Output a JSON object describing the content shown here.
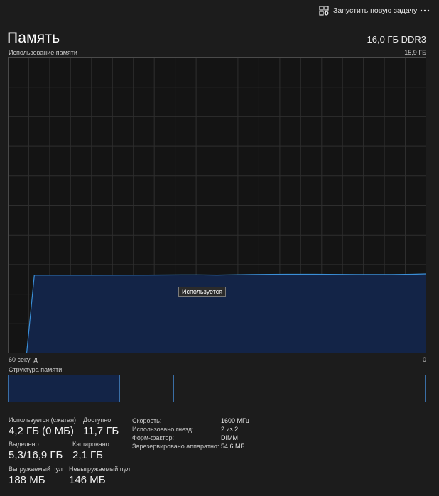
{
  "toolbar": {
    "run_task_label": "Запустить новую задачу",
    "more_label": "...",
    "run_task_icon": "new-task-icon",
    "more_icon": "more-horizontal-icon"
  },
  "header": {
    "title": "Память",
    "total": "16,0 ГБ DDR3",
    "usage_label": "Использование памяти",
    "usage_max": "15,9 ГБ"
  },
  "chart_data": {
    "type": "area",
    "x_range": [
      60,
      0
    ],
    "xlabel_left": "60 секунд",
    "xlabel_right": "0",
    "ylim": [
      0,
      15.9
    ],
    "grid": true,
    "color": "#3a8fd8",
    "fill": "#132447",
    "series": [
      {
        "x": [
          60,
          57.3,
          56.2,
          50,
          40,
          33,
          30,
          25,
          20,
          16,
          10,
          5,
          2,
          0
        ],
        "values": [
          0,
          0,
          4.2,
          4.2,
          4.21,
          4.22,
          4.21,
          4.24,
          4.25,
          4.25,
          4.24,
          4.24,
          4.25,
          4.27
        ]
      }
    ],
    "tooltip": "Используется"
  },
  "structure": {
    "label": "Структура памяти"
  },
  "stats": {
    "in_use_label": "Используется (сжатая)",
    "in_use_value": "4,2 ГБ (0 МБ)",
    "available_label": "Доступно",
    "available_value": "11,7 ГБ",
    "committed_label": "Выделено",
    "committed_value": "5,3/16,9 ГБ",
    "cached_label": "Кэшировано",
    "cached_value": "2,1 ГБ",
    "paged_label": "Выгружаемый пул",
    "paged_value": "188 МБ",
    "nonpaged_label": "Невыгружаемый пул",
    "nonpaged_value": "146 МБ"
  },
  "details": {
    "speed_label": "Скорость:",
    "speed_value": "1600 МГц",
    "slots_label": "Использовано гнезд:",
    "slots_value": "2 из 2",
    "form_label": "Форм-фактор:",
    "form_value": "DIMM",
    "reserved_label": "Зарезервировано аппаратно:",
    "reserved_value": "54,6 МБ"
  }
}
